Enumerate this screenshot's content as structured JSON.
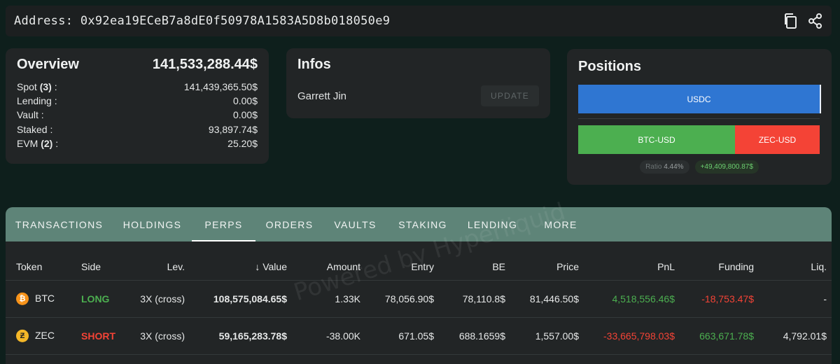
{
  "address": {
    "label": "Address:",
    "value": "0x92ea19ECeB7a8dE0f50978A1583A5D8b018050e9"
  },
  "overview": {
    "title": "Overview",
    "total": "141,533,288.44$",
    "rows": [
      {
        "label": "Spot",
        "count": "(3)",
        "suffix": " :",
        "value": "141,439,365.50$"
      },
      {
        "label": "Lending :",
        "count": "",
        "suffix": "",
        "value": "0.00$"
      },
      {
        "label": "Vault :",
        "count": "",
        "suffix": "",
        "value": "0.00$"
      },
      {
        "label": "Staked :",
        "count": "",
        "suffix": "",
        "value": "93,897.74$"
      },
      {
        "label": "EVM",
        "count": "(2)",
        "suffix": " :",
        "value": "25.20$"
      }
    ]
  },
  "infos": {
    "title": "Infos",
    "name": "Garrett Jin",
    "update_label": "UPDATE"
  },
  "positions": {
    "title": "Positions",
    "usdc_label": "USDC",
    "btc_label": "BTC-USD",
    "zec_label": "ZEC-USD",
    "ratio_label": "Ratio",
    "ratio_value": "4.44%",
    "pnl_value": "+49,409,800.87$"
  },
  "tabs": [
    "TRANSACTIONS",
    "HOLDINGS",
    "PERPS",
    "ORDERS",
    "VAULTS",
    "STAKING",
    "LENDING",
    "MORE"
  ],
  "active_tab": "PERPS",
  "table": {
    "headers": [
      "Token",
      "Side",
      "Lev.",
      "↓ Value",
      "Amount",
      "Entry",
      "BE",
      "Price",
      "PnL",
      "Funding",
      "Liq."
    ],
    "rows": [
      {
        "token": "BTC",
        "side": "LONG",
        "lev": "3X (cross)",
        "value": "108,575,084.65$",
        "amount": "1.33K",
        "entry": "78,056.90$",
        "be": "78,110.8$",
        "price": "81,446.50$",
        "pnl": "4,518,556.46$",
        "funding": "-18,753.47$",
        "liq": "-"
      },
      {
        "token": "ZEC",
        "side": "SHORT",
        "lev": "3X (cross)",
        "value": "59,165,283.78$",
        "amount": "-38.00K",
        "entry": "671.05$",
        "be": "688.1659$",
        "price": "1,557.00$",
        "pnl": "-33,665,798.03$",
        "funding": "663,671.78$",
        "liq": "4,792.01$"
      }
    ]
  },
  "watermark": "Powered by Hyperliquid",
  "colors": {
    "accent": "#5e8478",
    "usdc": "#2f76d2",
    "long": "#4caf50",
    "short": "#f44336"
  }
}
